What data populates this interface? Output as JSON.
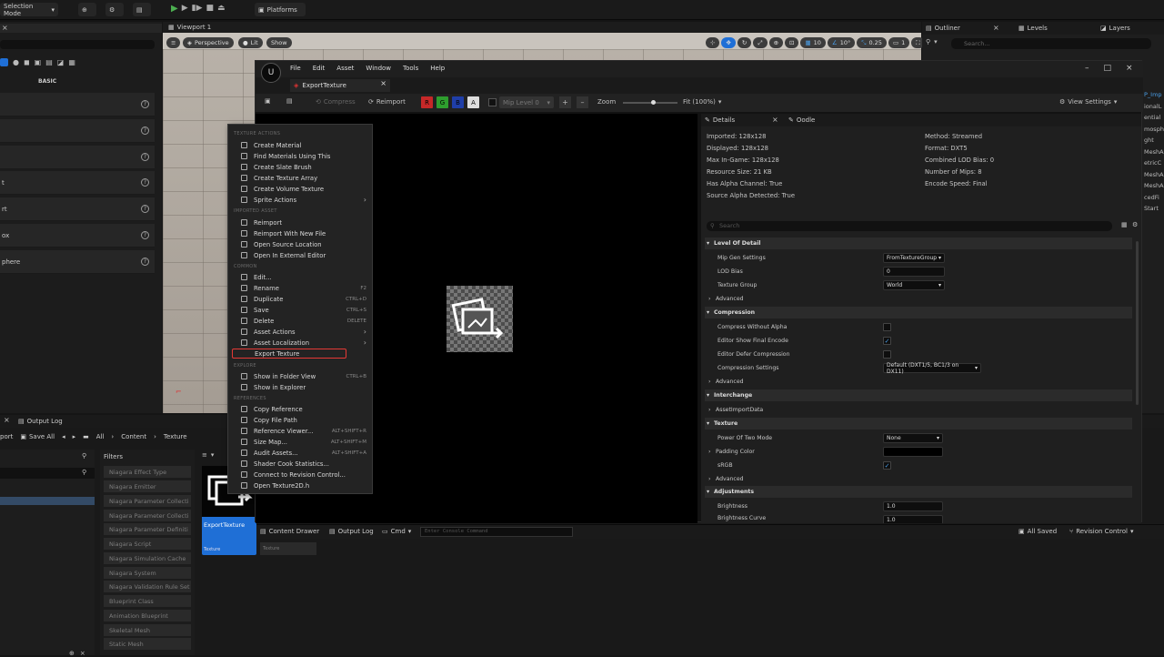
{
  "topbar": {
    "selection_mode": "Selection Mode",
    "platforms": "Platforms"
  },
  "left_panel": {
    "basic_label": "BASIC",
    "rows": [
      "",
      "",
      "",
      "t",
      "rt",
      "ox",
      "phere"
    ]
  },
  "viewport": {
    "tab_label": "Viewport 1",
    "perspective": "Perspective",
    "lit": "Lit",
    "show": "Show",
    "grid_snap": "10",
    "rot_snap": "10°",
    "scale_snap": "0.25",
    "cam_speed": "1"
  },
  "outliner": {
    "tab_outliner": "Outliner",
    "tab_levels": "Levels",
    "tab_layers": "Layers",
    "search_placeholder": "Search...",
    "truncated_items": [
      "P_Imp",
      "ionalL",
      "ential",
      "mosph",
      "ght",
      "MeshA",
      "etricC",
      "MeshA",
      "MeshA",
      "cedFi",
      "Start"
    ]
  },
  "texture_window": {
    "menu": [
      "File",
      "Edit",
      "Asset",
      "Window",
      "Tools",
      "Help"
    ],
    "tab_title": "ExportTexture",
    "toolbar": {
      "compress": "Compress",
      "reimport": "Reimport",
      "channels": [
        "R",
        "G",
        "B",
        "A"
      ],
      "mip_level": "Mip Level 0",
      "zoom_label": "Zoom",
      "zoom_value": "Fit (100%)",
      "view_settings": "View Settings"
    },
    "details_tab": "Details",
    "oodle_tab": "Oodle",
    "info_left": [
      "Imported: 128x128",
      "Displayed: 128x128",
      "Max In-Game: 128x128",
      "Resource Size: 21 KB",
      "Has Alpha Channel: True",
      "Source Alpha Detected: True"
    ],
    "info_right": [
      "Method: Streamed",
      "Format: DXT5",
      "Combined LOD Bias: 0",
      "Number of Mips: 8",
      "Encode Speed: Final"
    ],
    "search_placeholder": "Search",
    "sections": {
      "lod": "Level Of Detail",
      "compression": "Compression",
      "interchange": "Interchange",
      "texture": "Texture",
      "adjustments": "Adjustments"
    },
    "props": {
      "mip_gen": "Mip Gen Settings",
      "mip_gen_val": "FromTextureGroup",
      "lod_bias": "LOD Bias",
      "lod_bias_val": "0",
      "texture_group": "Texture Group",
      "texture_group_val": "World",
      "advanced": "Advanced",
      "compress_no_alpha": "Compress Without Alpha",
      "show_final_encode": "Editor Show Final Encode",
      "defer_compression": "Editor Defer Compression",
      "compression_settings": "Compression Settings",
      "compression_settings_val": "Default (DXT1/5, BC1/3 on DX11)",
      "asset_import_data": "AssetImportData",
      "power_of_two": "Power Of Two Mode",
      "power_of_two_val": "None",
      "padding_color": "Padding Color",
      "srgb": "sRGB",
      "brightness": "Brightness",
      "brightness_val": "1.0",
      "brightness_curve": "Brightness Curve",
      "brightness_curve_val": "1.0"
    }
  },
  "context_menu": {
    "headers": [
      "TEXTURE ACTIONS",
      "IMPORTED ASSET",
      "COMMON",
      "EXPLORE",
      "REFERENCES"
    ],
    "texture_actions": [
      "Create Material",
      "Find Materials Using This",
      "Create Slate Brush",
      "Create Texture Array",
      "Create Volume Texture",
      "Sprite Actions"
    ],
    "imported_asset": [
      "Reimport",
      "Reimport With New File",
      "Open Source Location",
      "Open In External Editor"
    ],
    "common": [
      "Edit...",
      "Rename",
      "Duplicate",
      "Save",
      "Delete",
      "Asset Actions",
      "Asset Localization",
      "Export Texture"
    ],
    "common_shortcuts": [
      "",
      "F2",
      "CTRL+D",
      "CTRL+S",
      "DELETE",
      "",
      "",
      ""
    ],
    "explore": [
      "Show in Folder View",
      "Show in Explorer"
    ],
    "explore_shortcuts": [
      "CTRL+B",
      ""
    ],
    "references": [
      "Copy Reference",
      "Copy File Path",
      "Reference Viewer...",
      "Size Map...",
      "Audit Assets...",
      "Shader Cook Statistics...",
      "Connect to Revision Control...",
      "Open Texture2D.h"
    ],
    "references_shortcuts": [
      "",
      "",
      "ALT+SHIFT+R",
      "ALT+SHIFT+M",
      "ALT+SHIFT+A",
      "",
      "",
      ""
    ]
  },
  "bottom": {
    "output_log_tab": "Output Log",
    "import": "port",
    "save_all": "Save All",
    "breadcrumb": [
      "All",
      "Content",
      "Texture"
    ],
    "filters_label": "Filters",
    "filters": [
      "Niagara Effect Type",
      "Niagara Emitter",
      "Niagara Parameter Collecti",
      "Niagara Parameter Collecti",
      "Niagara Parameter Definiti",
      "Niagara Script",
      "Niagara Simulation Cache",
      "Niagara System",
      "Niagara Validation Rule Set",
      "Blueprint Class",
      "Animation Blueprint",
      "Skeletal Mesh",
      "Static Mesh"
    ],
    "asset_name": "ExportTexture",
    "asset_type": "Texture",
    "asset_type2": "Texture",
    "content_drawer": "Content Drawer",
    "output_log": "Output Log",
    "cmd": "Cmd",
    "console_placeholder": "Enter Console Command",
    "all_saved": "All Saved",
    "revision_control": "Revision Control"
  }
}
